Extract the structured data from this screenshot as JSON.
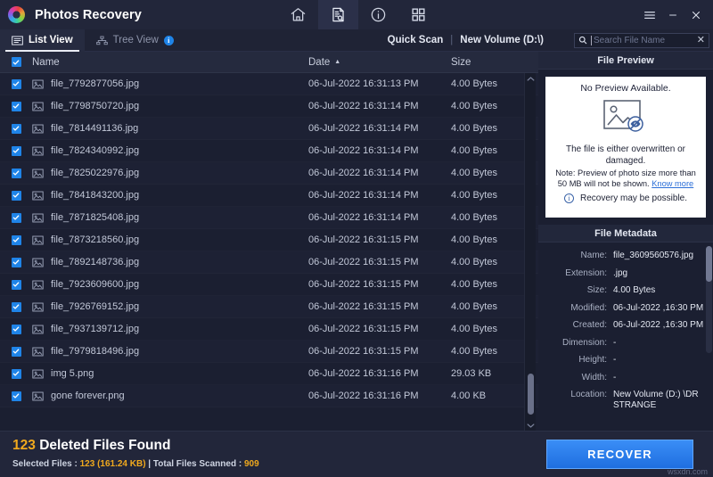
{
  "app": {
    "title": "Photos Recovery",
    "logo_icon": "photos-recovery-logo"
  },
  "titlebar": {
    "icons": [
      {
        "name": "home-icon",
        "label": "Home",
        "active": false
      },
      {
        "name": "scan-document-icon",
        "label": "Scan",
        "active": true
      },
      {
        "name": "info-icon",
        "label": "Info",
        "active": false
      },
      {
        "name": "grid-icon",
        "label": "Grid",
        "active": false
      }
    ],
    "window_controls": [
      {
        "name": "menu-icon",
        "label": "☰"
      },
      {
        "name": "minimize-icon",
        "label": "−"
      },
      {
        "name": "close-icon",
        "label": "✕"
      }
    ]
  },
  "subbar": {
    "tabs": [
      {
        "label": "List View",
        "icon": "list-view-icon",
        "active": true,
        "badge": ""
      },
      {
        "label": "Tree View",
        "icon": "tree-view-icon",
        "active": false,
        "badge": "i"
      }
    ],
    "scan_mode": "Quick Scan",
    "separator": "|",
    "volume": "New Volume (D:\\)",
    "search": {
      "placeholder": "Search File Name",
      "value": "",
      "icon": "search-icon",
      "clear_icon": "close-icon",
      "clear_label": "✕"
    }
  },
  "list": {
    "columns": {
      "name": "Name",
      "date": "Date",
      "size": "Size"
    },
    "sort": {
      "column": "Date",
      "direction": "asc",
      "arrow": "▲"
    },
    "select_all_checked": true,
    "rows": [
      {
        "name": "file_7792877056.jpg",
        "date": "06-Jul-2022 16:31:13 PM",
        "size": "4.00 Bytes",
        "checked": true,
        "icon": "image-file-icon"
      },
      {
        "name": "file_7798750720.jpg",
        "date": "06-Jul-2022 16:31:14 PM",
        "size": "4.00 Bytes",
        "checked": true,
        "icon": "image-file-icon"
      },
      {
        "name": "file_7814491136.jpg",
        "date": "06-Jul-2022 16:31:14 PM",
        "size": "4.00 Bytes",
        "checked": true,
        "icon": "image-file-icon"
      },
      {
        "name": "file_7824340992.jpg",
        "date": "06-Jul-2022 16:31:14 PM",
        "size": "4.00 Bytes",
        "checked": true,
        "icon": "image-file-icon"
      },
      {
        "name": "file_7825022976.jpg",
        "date": "06-Jul-2022 16:31:14 PM",
        "size": "4.00 Bytes",
        "checked": true,
        "icon": "image-file-icon"
      },
      {
        "name": "file_7841843200.jpg",
        "date": "06-Jul-2022 16:31:14 PM",
        "size": "4.00 Bytes",
        "checked": true,
        "icon": "image-file-icon"
      },
      {
        "name": "file_7871825408.jpg",
        "date": "06-Jul-2022 16:31:14 PM",
        "size": "4.00 Bytes",
        "checked": true,
        "icon": "image-file-icon"
      },
      {
        "name": "file_7873218560.jpg",
        "date": "06-Jul-2022 16:31:15 PM",
        "size": "4.00 Bytes",
        "checked": true,
        "icon": "image-file-icon"
      },
      {
        "name": "file_7892148736.jpg",
        "date": "06-Jul-2022 16:31:15 PM",
        "size": "4.00 Bytes",
        "checked": true,
        "icon": "image-file-icon"
      },
      {
        "name": "file_7923609600.jpg",
        "date": "06-Jul-2022 16:31:15 PM",
        "size": "4.00 Bytes",
        "checked": true,
        "icon": "image-file-icon"
      },
      {
        "name": "file_7926769152.jpg",
        "date": "06-Jul-2022 16:31:15 PM",
        "size": "4.00 Bytes",
        "checked": true,
        "icon": "image-file-icon"
      },
      {
        "name": "file_7937139712.jpg",
        "date": "06-Jul-2022 16:31:15 PM",
        "size": "4.00 Bytes",
        "checked": true,
        "icon": "image-file-icon"
      },
      {
        "name": "file_7979818496.jpg",
        "date": "06-Jul-2022 16:31:15 PM",
        "size": "4.00 Bytes",
        "checked": true,
        "icon": "image-file-icon"
      },
      {
        "name": "img 5.png",
        "date": "06-Jul-2022 16:31:16 PM",
        "size": "29.03 KB",
        "checked": true,
        "icon": "image-file-icon"
      },
      {
        "name": "gone forever.png",
        "date": "06-Jul-2022 16:31:16 PM",
        "size": "4.00 KB",
        "checked": true,
        "icon": "image-file-icon"
      }
    ]
  },
  "preview": {
    "title": "File Preview",
    "no_preview": "No Preview Available.",
    "placeholder_icon": "broken-image-icon",
    "message": "The file is either overwritten or damaged.",
    "note": "Note: Preview of photo size more than 50 MB will not be shown.",
    "know_more": "Know more",
    "recovery_info_icon": "info-icon",
    "recovery_note": "Recovery may be possible."
  },
  "metadata": {
    "title": "File Metadata",
    "fields": [
      {
        "key": "Name:",
        "value": "file_3609560576.jpg"
      },
      {
        "key": "Extension:",
        "value": ".jpg"
      },
      {
        "key": "Size:",
        "value": "4.00 Bytes"
      },
      {
        "key": "Modified:",
        "value": "06-Jul-2022 ,16:30 PM"
      },
      {
        "key": "Created:",
        "value": "06-Jul-2022 ,16:30 PM"
      },
      {
        "key": "Dimension:",
        "value": "-"
      },
      {
        "key": "Height:",
        "value": "-"
      },
      {
        "key": "Width:",
        "value": "-"
      },
      {
        "key": "Location:",
        "value": "New Volume (D:) \\DR STRANGE"
      }
    ]
  },
  "footer": {
    "found_count": "123",
    "found_label": "Deleted Files Found",
    "selected_prefix": "Selected Files : ",
    "selected_count": "123",
    "selected_size": "(161.24 KB)",
    "scanned_prefix": " | Total Files Scanned : ",
    "scanned_count": "909",
    "recover_label": "RECOVER",
    "watermark": "wsxdn.com"
  },
  "colors": {
    "accent_blue": "#1f84e8",
    "amber": "#f0a91e",
    "panel_bg": "#1b1f31",
    "titlebar_bg": "#22263a",
    "link_blue": "#2c6fd8"
  }
}
